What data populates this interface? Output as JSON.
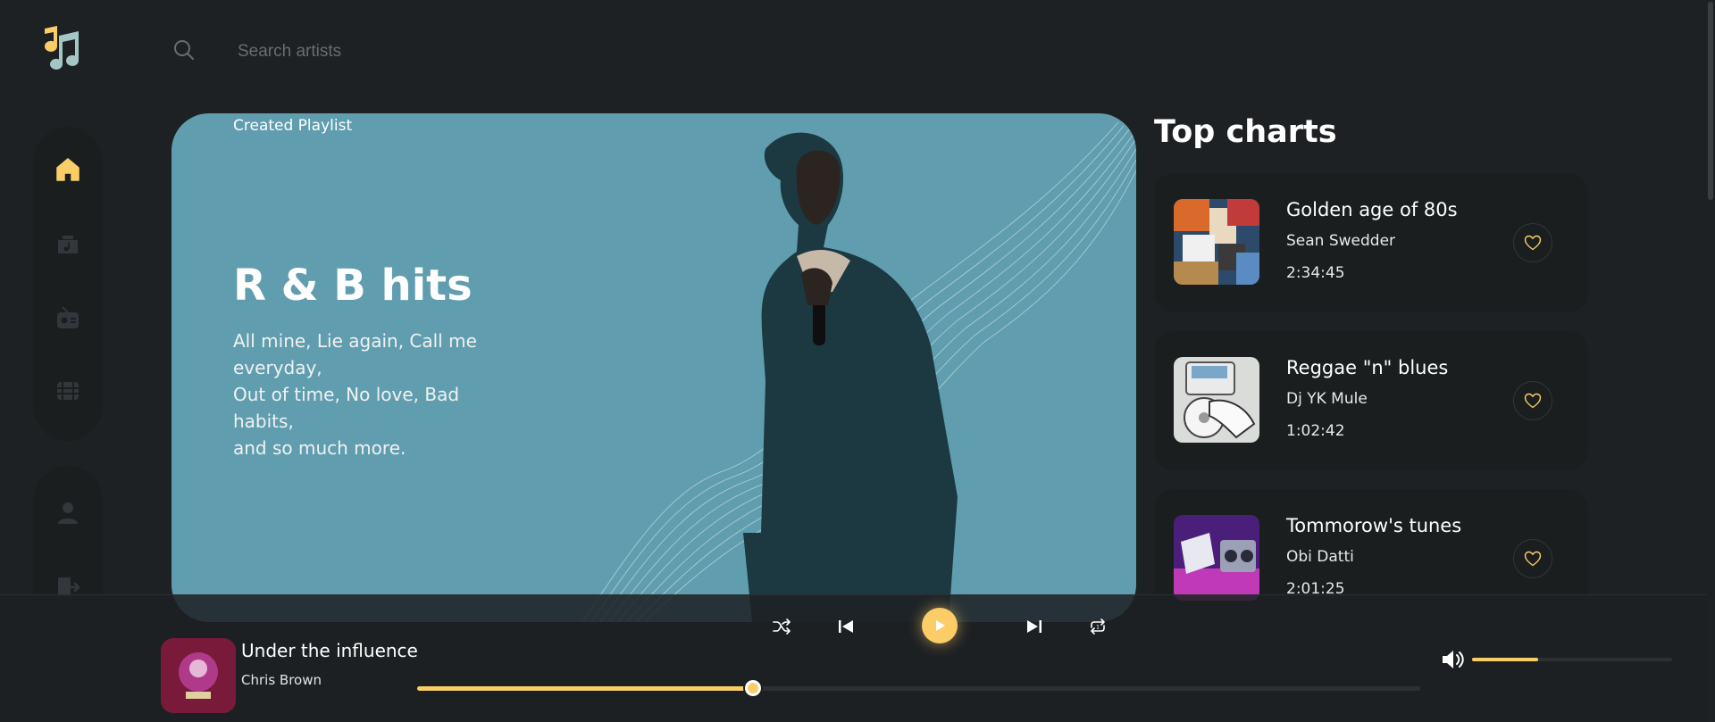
{
  "search": {
    "placeholder": "Search artists"
  },
  "hero": {
    "tag": "Created Playlist",
    "title": "R & B hits",
    "description_lines": [
      "All mine, Lie again, Call me",
      "everyday,",
      "Out of time, No love, Bad",
      "habits,",
      "and so much more."
    ]
  },
  "charts": {
    "title": "Top charts",
    "items": [
      {
        "name": "Golden age of 80s",
        "artist": "Sean Swedder",
        "duration": "2:34:45"
      },
      {
        "name": "Reggae \"n\" blues",
        "artist": "Dj YK Mule",
        "duration": "1:02:42"
      },
      {
        "name": "Tommorow's tunes",
        "artist": "Obi Datti",
        "duration": "2:01:25"
      }
    ]
  },
  "player": {
    "title": "Under the influence",
    "artist": "Chris Brown",
    "progress": 0.335,
    "volume": 0.33
  },
  "colors": {
    "accent": "#facd66",
    "background": "#1d2123",
    "panel": "#1a1e1f",
    "hero": "#609eaf"
  }
}
